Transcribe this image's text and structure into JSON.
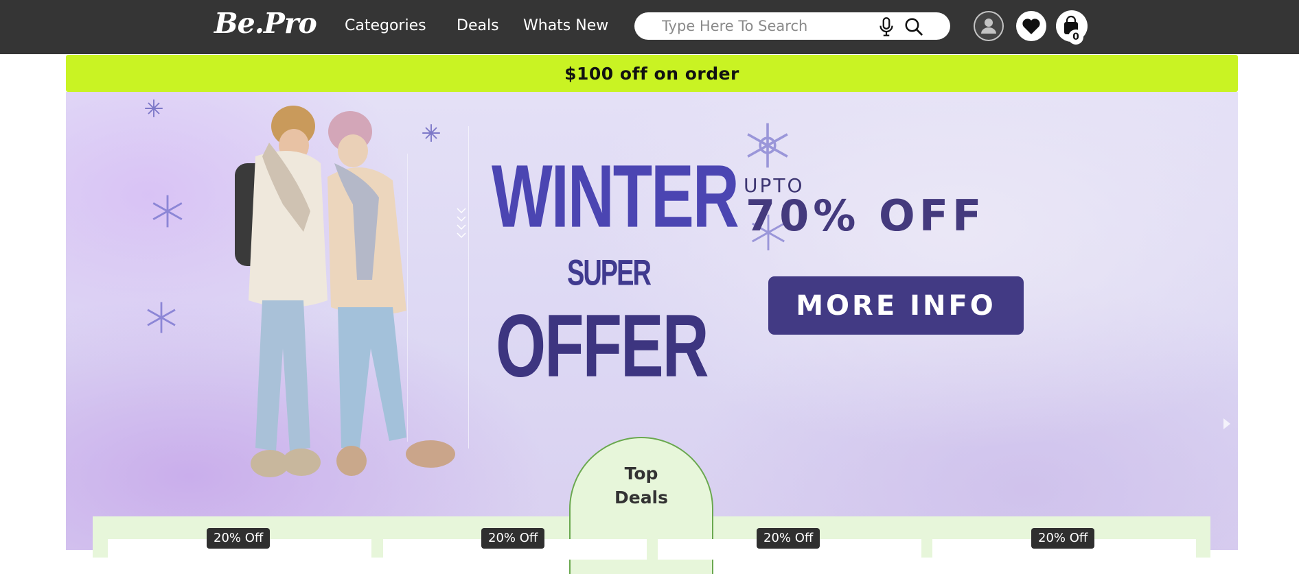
{
  "header": {
    "logo": "Be.Pro",
    "nav": [
      {
        "label": "Categories"
      },
      {
        "label": "Deals"
      },
      {
        "label": "Whats New"
      }
    ],
    "search": {
      "placeholder": "Type Here To Search",
      "value": ""
    },
    "icons": [
      "account-icon",
      "heart-icon",
      "shopping-bag-icon",
      "mic-icon",
      "search-icon"
    ],
    "cart_count": "0"
  },
  "promo": {
    "text": "$100 off on order"
  },
  "hero": {
    "line1": "WINTER",
    "line2": "SUPER",
    "line3": "OFFER",
    "upto": "UPTO",
    "discount": "70% OFF",
    "button_label": "MORE INFO"
  },
  "top_deals": {
    "title_line1": "Top",
    "title_line2": "Deals",
    "badges": [
      "20% Off",
      "20% Off",
      "20% Off",
      "20% Off"
    ]
  },
  "colors": {
    "header_bg": "#353535",
    "promo_bg": "#c9f323",
    "hero_text": "#4b45b2",
    "button_bg": "#423a84",
    "deals_bg": "#e7f6da"
  }
}
